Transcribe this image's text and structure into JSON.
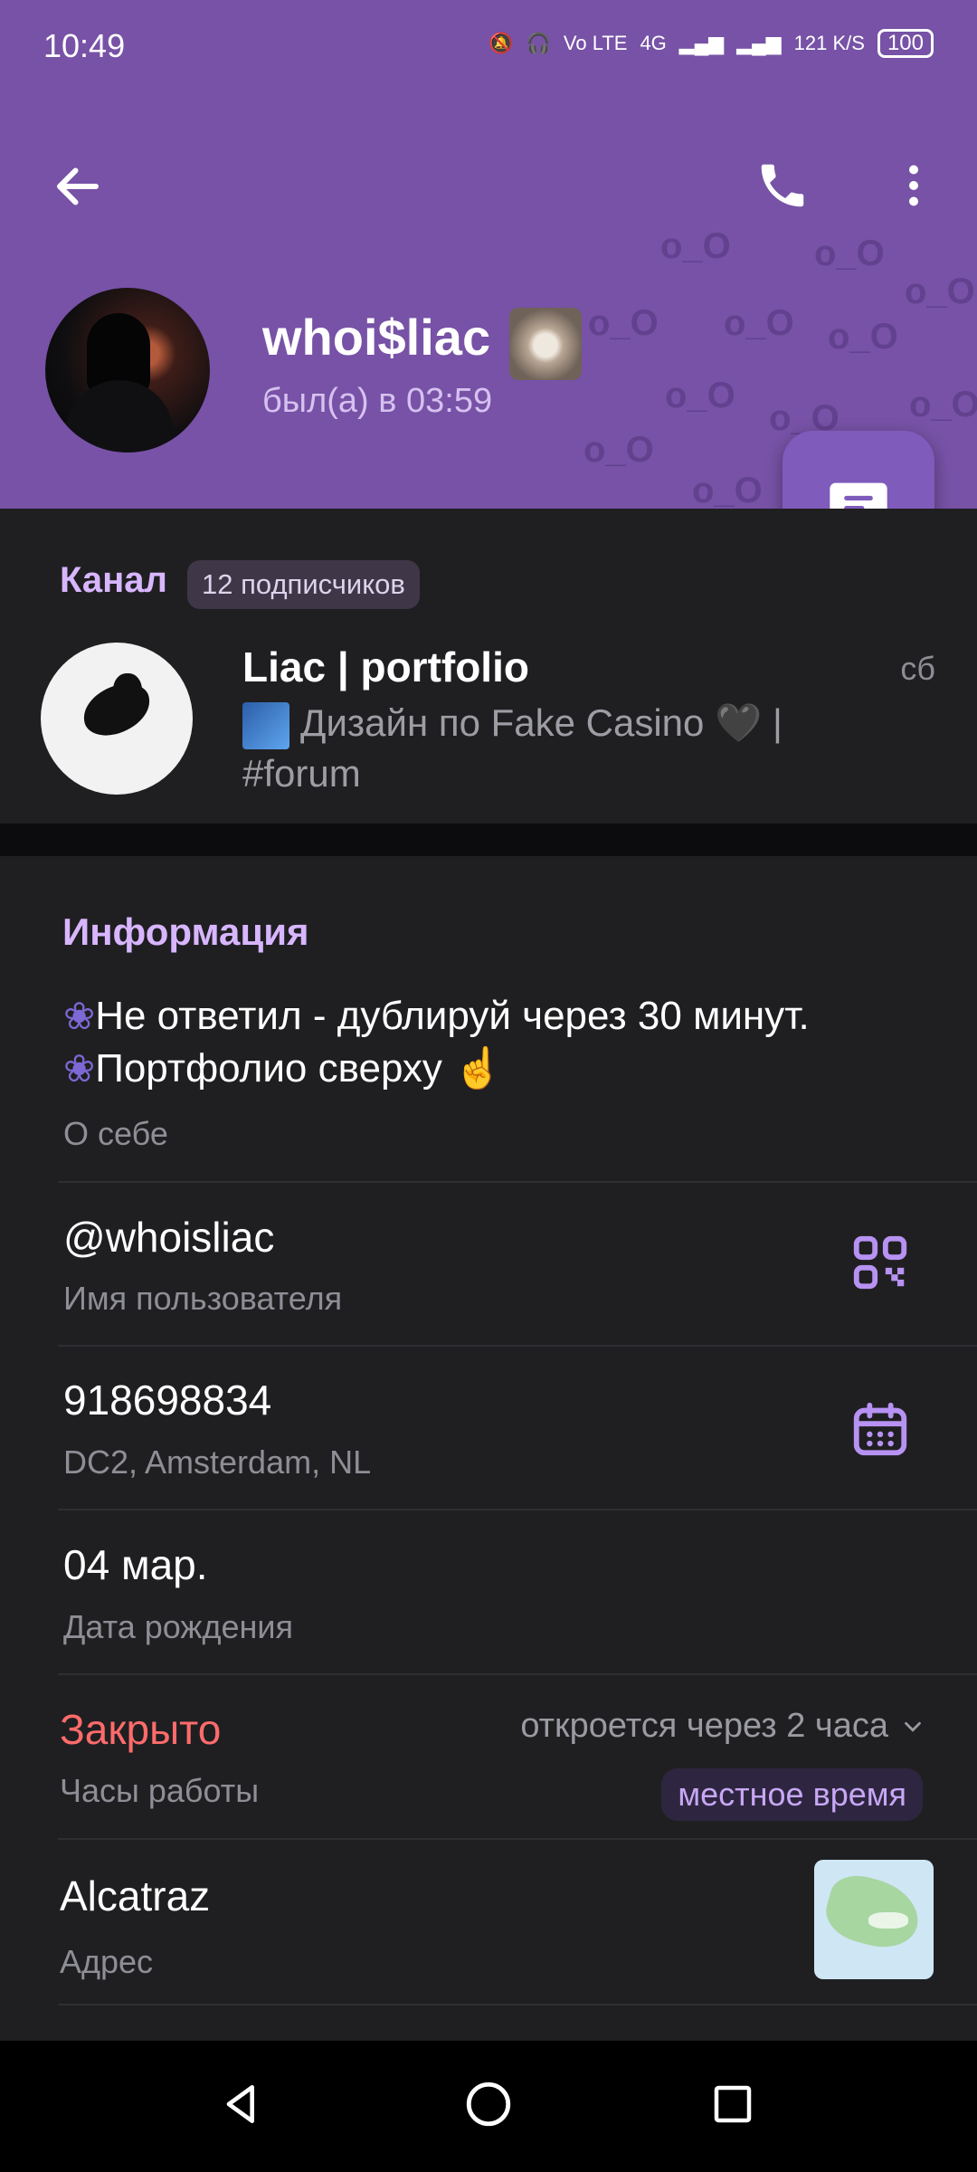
{
  "status_bar": {
    "time": "10:49",
    "network_label": "Vo LTE",
    "signal_label": "4G",
    "speed_label": "121 K/S",
    "battery": "100"
  },
  "header": {
    "name": "whoi$liac",
    "last_seen": "был(а) в 03:59",
    "pattern_text": "o_O"
  },
  "channel": {
    "label": "Канал",
    "subscribers": "12 подписчиков",
    "title": "Liac | portfolio",
    "date": "сб",
    "description": "Дизайн по Fake Casino 🖤 | #forum"
  },
  "info": {
    "title": "Информация",
    "about_line1": "Не ответил - дублируй через 30 минут.",
    "about_line2": "Портфолио сверху ☝️",
    "about_label": "О себе",
    "username": "@whoisliac",
    "username_label": "Имя пользователя",
    "id": "918698834",
    "dc": "DC2, Amsterdam, NL",
    "birthday": "04 мар.",
    "birthday_label": "Дата рождения",
    "hours_status": "Закрыто",
    "hours_opens": "откроется через 2 часа",
    "hours_label": "Часы работы",
    "local_time": "местное время",
    "address": "Alcatraz",
    "address_label": "Адрес"
  },
  "colors": {
    "header": "#7752a6",
    "accent": "#d8b6ff",
    "closed": "#ff6b6b",
    "background": "#1f1f21"
  }
}
